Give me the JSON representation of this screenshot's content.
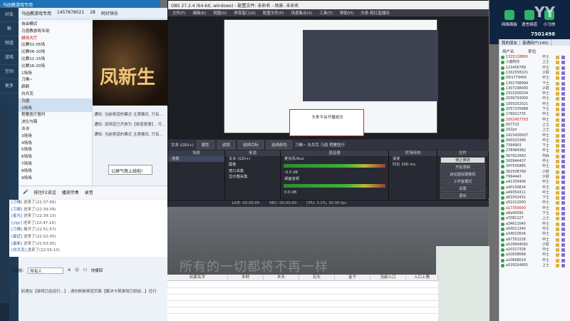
{
  "chat_window": {
    "title": "马函教游戏专用",
    "userbar": {
      "name": "马函教游戏专用",
      "id": "1457878021",
      "count": "28",
      "extra": "阿好快乐"
    },
    "left_icons": [
      "好友",
      "群",
      "频道",
      "游戏",
      "空间",
      "更多"
    ],
    "tree": [
      {
        "label": "自由模式"
      },
      {
        "label": "马函教游戏专用",
        "red": false
      },
      {
        "label": "骑侍大厅",
        "red": true
      },
      {
        "label": "比赛01-05场"
      },
      {
        "label": "比赛06-10场"
      },
      {
        "label": "比赛11-15场"
      },
      {
        "label": "比赛16-20场"
      },
      {
        "label": "1场场"
      },
      {
        "label": "刀琳~"
      },
      {
        "label": "颜颜"
      },
      {
        "label": "白兵克"
      },
      {
        "label": "马函",
        "sel": true
      },
      {
        "label": "2场场",
        "sel": true
      },
      {
        "label": "程雁医疗暂时"
      },
      {
        "label": "决比与路"
      },
      {
        "label": "冰冰"
      },
      {
        "label": "3场场"
      },
      {
        "label": "4场场"
      },
      {
        "label": "5场场"
      },
      {
        "label": "6场场"
      },
      {
        "label": "7场场"
      },
      {
        "label": "8场场"
      },
      {
        "label": "9场场"
      }
    ],
    "banner_text": "凤新生",
    "sys_msgs": [
      "通知: 当前频道的模式 主席模式, 只有...",
      "通知: 该频道已开放为【频道表情】, 可...",
      "通知: 当前频道的模式 主席模式, 只有..."
    ],
    "announce": "公屏气氛上线啦!",
    "input_tools": [
      "按住F2说话",
      "播放伴奏",
      "录音"
    ],
    "input_placeholder": "点击这里...",
    "chatlog": [
      {
        "name": "[刀琳]",
        "text": "进来了(22:37:56)"
      },
      {
        "name": "[刀颖]",
        "text": "进来了(22:39:09)"
      },
      {
        "name": "[星光]",
        "text": "进来了(22:39:13)"
      },
      {
        "name": "[ylgr]",
        "text": "进来了(22:47:14)"
      },
      {
        "name": "[刀琳]",
        "text": "离开了(22:51:57)"
      },
      {
        "name": "[最近]",
        "text": "进来了(22:52:05)"
      },
      {
        "name": "[最新]",
        "text": "进来了(22:53:05)"
      },
      {
        "name": "[白兵克]",
        "text": "进来了(22:55:10)"
      }
    ],
    "send_label": "发送给:",
    "send_target": "所有人",
    "send_option": "快捷回",
    "tip": "提示: 如遇在【游戏已经运行...】, 请勿刷新频道页面【解决卡顿游戏已卸结...】还行"
  },
  "obs": {
    "title": "OBS 27.2.4 (64-bit, windows) - 配置文件: 未命名 - 场景: 未命名",
    "menu": [
      "文件(F)",
      "编辑(E)",
      "视图(V)",
      "停靠窗口(D)",
      "配置文件(P)",
      "场景集合(S)",
      "工具(T)",
      "帮助(H)",
      "头条·肩扛直播间"
    ],
    "preview_banner": "头条平台开播成功",
    "toolbar_source": "文本 (GDI+)",
    "toolbar_btns": [
      "属性",
      "滤镜",
      "选择目标",
      "选择颜色"
    ],
    "toolbar_text": "刀琳~ 白兵克 马函 程雁医疗",
    "docks": {
      "scenes": {
        "title": "场景",
        "items": [
          "场景"
        ]
      },
      "sources": {
        "title": "来源",
        "items": [
          "文本 (GDI+)",
          "图像",
          "窗口采集",
          "显示器采集"
        ]
      },
      "mixer": {
        "title": "混音器",
        "tracks": [
          {
            "name": "麦克风/Aux",
            "db": "-0.0 dB"
          },
          {
            "name": "桌面音频",
            "db": "0.0 dB"
          }
        ]
      },
      "transitions": {
        "title": "转场特效",
        "type": "渐变",
        "duration_label": "时长",
        "duration": "300 ms"
      },
      "controls": {
        "title": "控件",
        "buttons": [
          "停止推流",
          "开始录制",
          "启动虚拟摄像机",
          "工作室模式",
          "设置",
          "退出"
        ]
      }
    },
    "status": [
      "LIVE: 00:00:00",
      "REC: 00:00:00",
      "CPU: 3.1%, 30.00 fps"
    ]
  },
  "subtitle": "所有的一切都将不再一样",
  "sheet": {
    "headers": [
      "玩家名字",
      "木材",
      "木头",
      "石头",
      "金子",
      "当前入口",
      "入口上限"
    ]
  },
  "desktop": {
    "icons": [
      "网络面板",
      "语言频道",
      "小马快"
    ],
    "big_text": "YY",
    "number_text": "7501498"
  },
  "player_list": {
    "tabs": [
      "我的朋友",
      "普通网户(140)"
    ],
    "headers": [
      "用户名",
      "职位"
    ],
    "rows": [
      {
        "name": "1325118800",
        "pos": "中士",
        "red": true
      },
      {
        "name": "小鹿快乐",
        "pos": "上士",
        "red": false
      },
      {
        "name": "123456789",
        "pos": "中士",
        "red": false
      },
      {
        "name": "1302558101",
        "pos": "少尉",
        "red": false
      },
      {
        "name": "l001779400",
        "pos": "中士",
        "red": false
      },
      {
        "name": "1301798994",
        "pos": "下士",
        "red": false
      },
      {
        "name": "1307298000",
        "pos": "少尉",
        "red": false
      },
      {
        "name": "2310200034",
        "pos": "中士",
        "red": false
      },
      {
        "name": "2036793000",
        "pos": "中士",
        "red": false
      },
      {
        "name": "1005252021",
        "pos": "中士",
        "red": false
      },
      {
        "name": "2057235888",
        "pos": "下士",
        "red": false
      },
      {
        "name": "176021735",
        "pos": "中士",
        "red": false
      },
      {
        "name": "1002457793",
        "pos": "中士",
        "red": true
      },
      {
        "name": "007723",
        "pos": "上士",
        "red": false
      },
      {
        "name": "202jor",
        "pos": "上士",
        "red": false
      },
      {
        "name": "2423436937",
        "pos": "中士",
        "red": false
      },
      {
        "name": "000323366",
        "pos": "中士",
        "red": false
      },
      {
        "name": "7394903",
        "pos": "下士",
        "red": false
      },
      {
        "name": "278484382",
        "pos": "中士",
        "red": false
      },
      {
        "name": "567922683",
        "pos": "列兵",
        "red": false
      },
      {
        "name": "300944437",
        "pos": "中士",
        "red": false
      },
      {
        "name": "347505885",
        "pos": "中士",
        "red": false
      },
      {
        "name": "362508768",
        "pos": "少尉",
        "red": false
      },
      {
        "name": "7994443",
        "pos": "少尉",
        "red": false
      },
      {
        "name": "a41330408",
        "pos": "中士",
        "red": false
      },
      {
        "name": "a40100834",
        "pos": "中士",
        "red": false
      },
      {
        "name": "a49354311",
        "pos": "中士",
        "red": false
      },
      {
        "name": "a61002432",
        "pos": "下士",
        "red": false
      },
      {
        "name": "a51012000",
        "pos": "中士",
        "red": false
      },
      {
        "name": "a17350000",
        "pos": "中士",
        "red": true
      },
      {
        "name": "a8a40092",
        "pos": "下士",
        "red": false
      },
      {
        "name": "a7081127",
        "pos": "上士",
        "red": false
      },
      {
        "name": "a34011040",
        "pos": "中士",
        "red": false
      },
      {
        "name": "a54011340",
        "pos": "中士",
        "red": false
      },
      {
        "name": "a34010504",
        "pos": "中士",
        "red": false
      },
      {
        "name": "a97352228",
        "pos": "中士",
        "red": false
      },
      {
        "name": "a029644092",
        "pos": "少尉",
        "red": false
      },
      {
        "name": "a20317338",
        "pos": "中士",
        "red": false
      },
      {
        "name": "a10058068",
        "pos": "中士",
        "red": false
      },
      {
        "name": "a10668029",
        "pos": "中士",
        "red": false
      },
      {
        "name": "a029324805",
        "pos": "上士",
        "red": false
      }
    ]
  }
}
